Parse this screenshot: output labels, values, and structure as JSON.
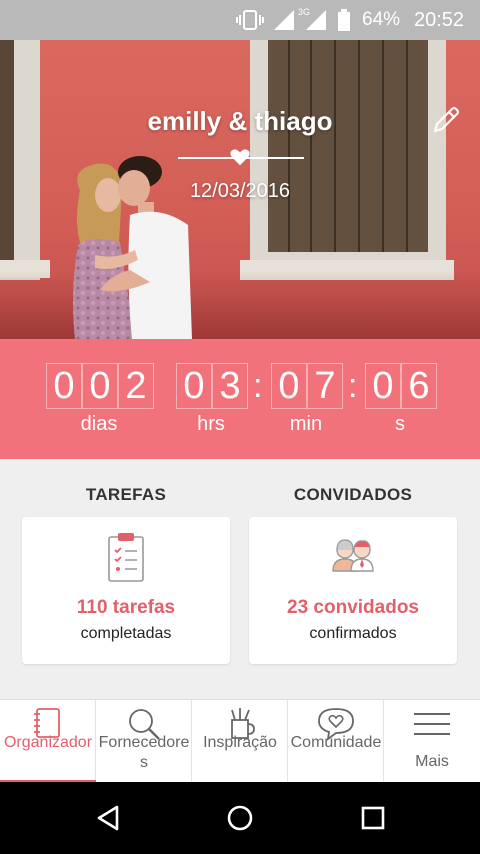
{
  "status_bar": {
    "battery_percent": "64%",
    "time": "20:52",
    "network_label": "3G",
    "icons": [
      "vibrate-icon",
      "signal-icon",
      "signal-3g-icon",
      "battery-icon"
    ]
  },
  "hero": {
    "couple_names": "emilly & thiago",
    "wedding_date": "12/03/2016",
    "edit_icon": "pencil-icon"
  },
  "countdown": {
    "days": [
      "0",
      "0",
      "2"
    ],
    "hours": [
      "0",
      "3"
    ],
    "minutes": [
      "0",
      "7"
    ],
    "seconds": [
      "0",
      "6"
    ],
    "separator": ":",
    "labels": {
      "days": "dias",
      "hours": "hrs",
      "minutes": "min",
      "seconds": "s"
    }
  },
  "sections": {
    "tasks": {
      "title": "TAREFAS",
      "count_text": "110 tarefas",
      "sub_text": "completadas",
      "icon": "clipboard-checklist-icon"
    },
    "guests": {
      "title": "CONVIDADOS",
      "count_text": "23 convidados",
      "sub_text": "confirmados",
      "icon": "guests-icon"
    }
  },
  "bottom_nav": [
    {
      "label": "Organizador",
      "icon": "notebook-icon",
      "active": true
    },
    {
      "label": "Fornecedores",
      "icon": "search-icon",
      "active": false
    },
    {
      "label": "Inspiração",
      "icon": "pencil-cup-icon",
      "active": false
    },
    {
      "label": "Comunidade",
      "icon": "heart-chat-icon",
      "active": false
    },
    {
      "label": "Mais",
      "icon": "menu-icon",
      "active": false
    }
  ],
  "colors": {
    "accent": "#f2727b",
    "accent_text": "#e2606a",
    "status_bar": "#b9b9b9",
    "content_bg": "#efefef"
  }
}
